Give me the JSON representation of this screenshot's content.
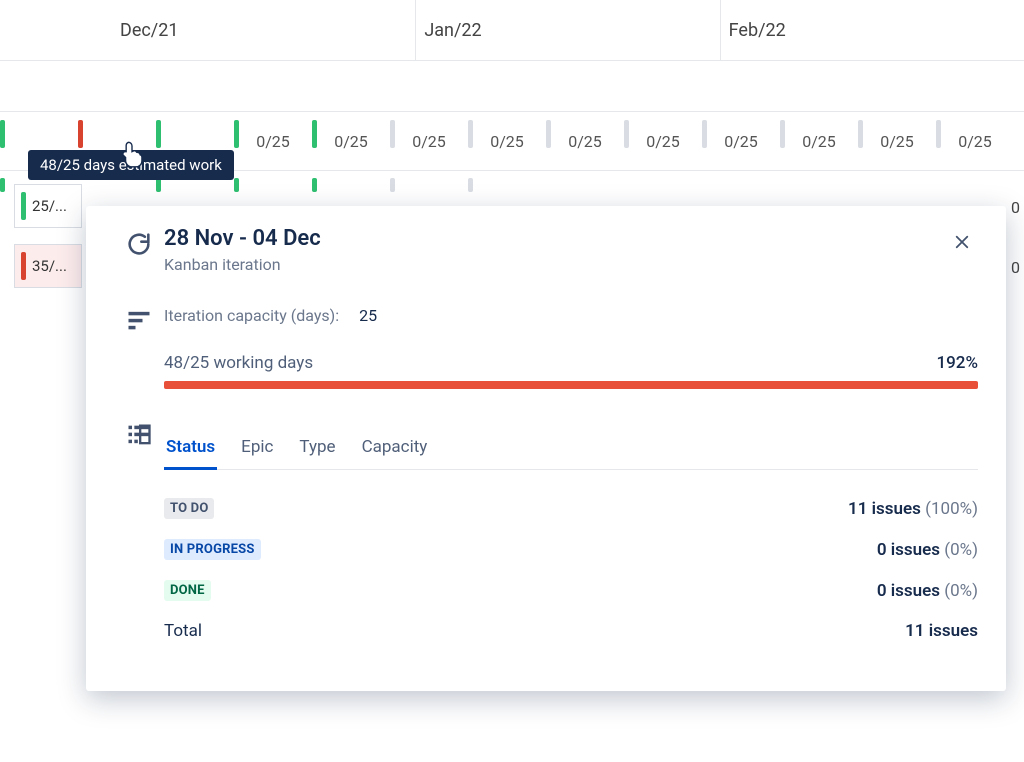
{
  "timeline": {
    "months": [
      "Dec/21",
      "Jan/22",
      "Feb/22"
    ],
    "cells": [
      {
        "label": "",
        "style": "green"
      },
      {
        "label": "",
        "style": "red"
      },
      {
        "label": "",
        "style": "green"
      },
      {
        "label": "0/25",
        "style": "green"
      },
      {
        "label": "0/25",
        "style": "green"
      },
      {
        "label": "0/25",
        "style": "mid"
      },
      {
        "label": "0/25",
        "style": "mid"
      },
      {
        "label": "0/25",
        "style": ""
      },
      {
        "label": "0/25",
        "style": ""
      },
      {
        "label": "0/25",
        "style": ""
      },
      {
        "label": "0/25",
        "style": ""
      },
      {
        "label": "0/25",
        "style": ""
      },
      {
        "label": "0/25",
        "style": ""
      }
    ]
  },
  "tooltip": "48/25 days estimated work",
  "chips": [
    {
      "label": "25/...",
      "color": "green",
      "bg": ""
    },
    {
      "label": "35/...",
      "color": "red",
      "bg": "red-bg"
    }
  ],
  "right_zeros": [
    "0",
    "0"
  ],
  "popup": {
    "date_range": "28 Nov - 04 Dec",
    "subtitle": "Kanban iteration",
    "capacity_label": "Iteration capacity (days):",
    "capacity_value": "25",
    "progress_label": "48/25 working days",
    "progress_pct": "192%",
    "tabs": [
      "Status",
      "Epic",
      "Type",
      "Capacity"
    ],
    "active_tab": 0,
    "statuses": [
      {
        "kind": "todo",
        "label": "TO DO",
        "count": "11 issues",
        "pct": "(100%)"
      },
      {
        "kind": "inprog",
        "label": "IN PROGRESS",
        "count": "0 issues",
        "pct": "(0%)"
      },
      {
        "kind": "done",
        "label": "DONE",
        "count": "0 issues",
        "pct": "(0%)"
      }
    ],
    "total_label": "Total",
    "total_value": "11 issues"
  }
}
